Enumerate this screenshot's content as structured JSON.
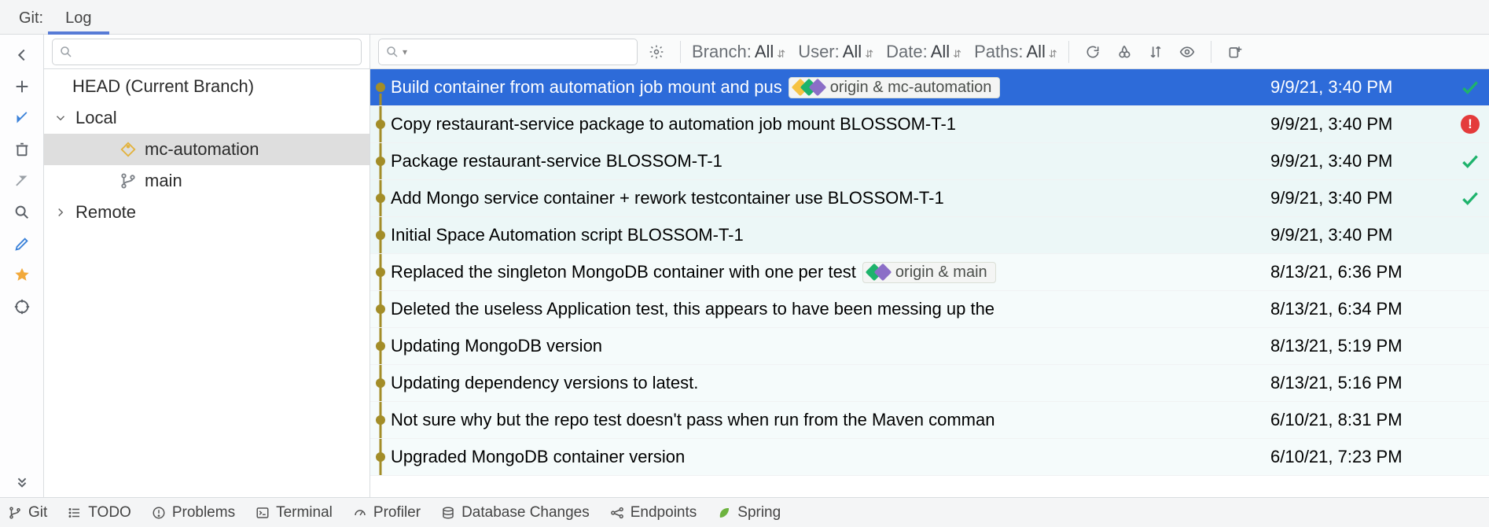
{
  "tabstrip": {
    "prefix": "Git:",
    "tabs": [
      {
        "label": "Log",
        "active": true
      }
    ]
  },
  "rail": {
    "back": "back-icon",
    "items": [
      "add-icon",
      "pull-icon",
      "delete-icon",
      "push-icon",
      "search-icon",
      "edit-icon",
      "star-icon",
      "target-icon"
    ],
    "more": "more-icon"
  },
  "tree": {
    "head": "HEAD (Current Branch)",
    "local_label": "Local",
    "remote_label": "Remote",
    "local_branches": [
      {
        "name": "mc-automation",
        "icon": "tag",
        "active": true
      },
      {
        "name": "main",
        "icon": "branch",
        "active": false
      }
    ]
  },
  "toolbar": {
    "search_placeholder": "",
    "gear": "Settings",
    "filters": {
      "branch_label": "Branch:",
      "branch_value": "All",
      "user_label": "User:",
      "user_value": "All",
      "date_label": "Date:",
      "date_value": "All",
      "paths_label": "Paths:",
      "paths_value": "All"
    },
    "actions": [
      "refresh-icon",
      "cherry-pick-icon",
      "sort-icon",
      "eye-icon",
      "new-branch-icon"
    ]
  },
  "commits": [
    {
      "msg": "Build container from automation job mount and pus",
      "tag": "origin & mc-automation",
      "tag_colors": [
        "#f6c343",
        "#1eb36c",
        "#8b6ec7"
      ],
      "date": "9/9/21, 3:40 PM",
      "status": "ok",
      "selected": true
    },
    {
      "msg": "Copy restaurant-service package to automation job mount BLOSSOM-T-1",
      "date": "9/9/21, 3:40 PM",
      "status": "err"
    },
    {
      "msg": "Package restaurant-service BLOSSOM-T-1",
      "date": "9/9/21, 3:40 PM",
      "status": "ok"
    },
    {
      "msg": "Add Mongo service container + rework testcontainer use BLOSSOM-T-1",
      "date": "9/9/21, 3:40 PM",
      "status": "ok"
    },
    {
      "msg": "Initial Space Automation script BLOSSOM-T-1",
      "date": "9/9/21, 3:40 PM",
      "status": ""
    },
    {
      "msg": "Replaced the singleton MongoDB container with one per test",
      "tag": "origin & main",
      "tag_colors": [
        "#1eb36c",
        "#8b6ec7"
      ],
      "date": "8/13/21, 6:36 PM",
      "status": ""
    },
    {
      "msg": "Deleted the useless Application test, this appears to have been messing up the",
      "date": "8/13/21, 6:34 PM",
      "status": ""
    },
    {
      "msg": "Updating MongoDB version",
      "date": "8/13/21, 5:19 PM",
      "status": ""
    },
    {
      "msg": "Updating dependency versions to latest.",
      "date": "8/13/21, 5:16 PM",
      "status": ""
    },
    {
      "msg": "Not sure why but the repo test doesn't pass when run from the Maven comman",
      "date": "6/10/21, 8:31 PM",
      "status": ""
    },
    {
      "msg": "Upgraded MongoDB container version",
      "date": "6/10/21, 7:23 PM",
      "status": ""
    }
  ],
  "statusbar": {
    "items": [
      {
        "label": "Git",
        "icon": "branch"
      },
      {
        "label": "TODO",
        "icon": "list"
      },
      {
        "label": "Problems",
        "icon": "warn"
      },
      {
        "label": "Terminal",
        "icon": "terminal"
      },
      {
        "label": "Profiler",
        "icon": "gauge"
      },
      {
        "label": "Database Changes",
        "icon": "db"
      },
      {
        "label": "Endpoints",
        "icon": "endpoints"
      },
      {
        "label": "Spring",
        "icon": "leaf"
      }
    ]
  }
}
